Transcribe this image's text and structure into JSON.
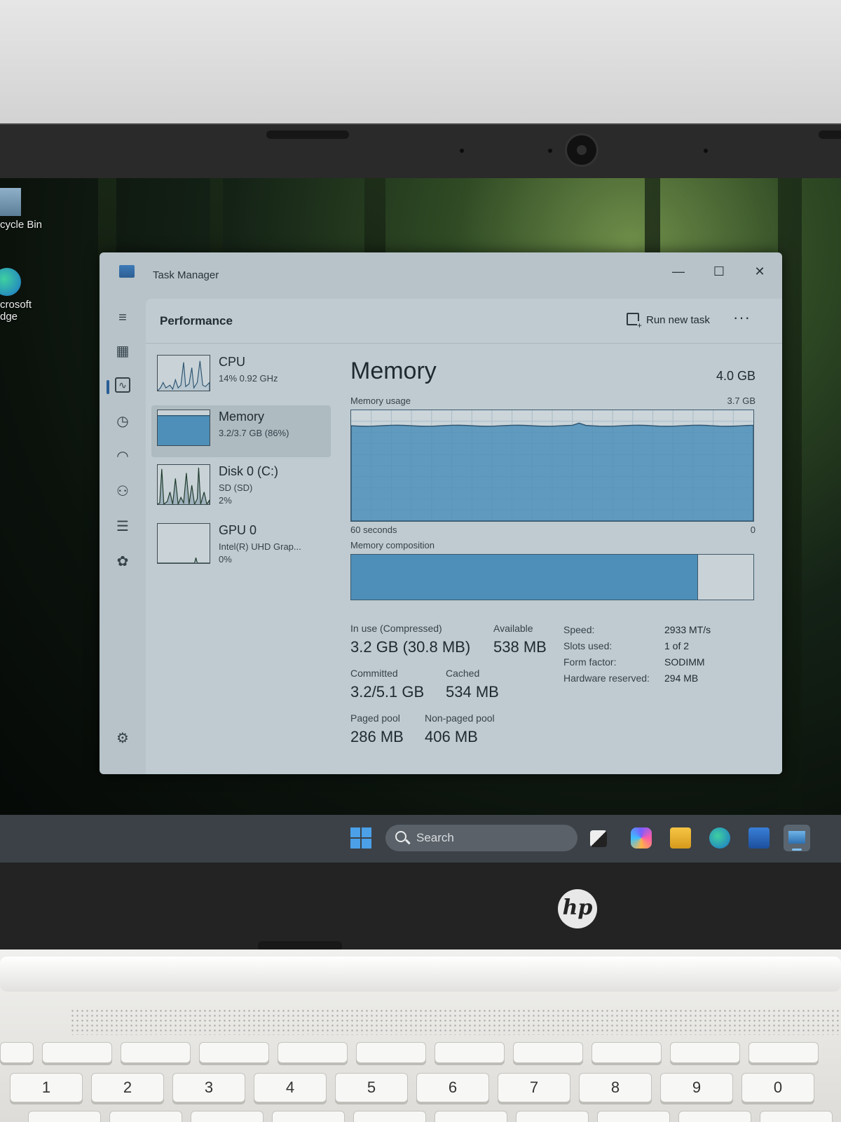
{
  "window": {
    "title": "Task Manager",
    "minimize": "—",
    "maximize": "☐",
    "close": "✕"
  },
  "desktop": {
    "recycle_bin": "cycle Bin",
    "edge_line1": "crosoft",
    "edge_line2": "dge"
  },
  "nav_icons": [
    "hamburger-icon",
    "processes-icon",
    "performance-icon",
    "app-history-icon",
    "startup-apps-icon",
    "users-icon",
    "details-icon",
    "services-icon",
    "settings-icon"
  ],
  "header": {
    "page_title": "Performance",
    "run_new_task": "Run new task",
    "more": "···"
  },
  "perf_list": [
    {
      "name": "CPU",
      "line1": "14% 0.92 GHz",
      "line2": ""
    },
    {
      "name": "Memory",
      "line1": "3.2/3.7 GB (86%)",
      "line2": ""
    },
    {
      "name": "Disk 0 (C:)",
      "line1": "SD (SD)",
      "line2": "2%"
    },
    {
      "name": "GPU 0",
      "line1": "Intel(R) UHD Grap...",
      "line2": "0%"
    }
  ],
  "memory": {
    "title": "Memory",
    "total": "4.0 GB",
    "usage_label": "Memory usage",
    "usage_max": "3.7 GB",
    "time_label": "60 seconds",
    "time_zero": "0",
    "composition_label": "Memory composition",
    "composition_in_use_fraction": 0.86,
    "usage_level_fraction": 0.86,
    "stats": {
      "in_use_label": "In use (Compressed)",
      "in_use_value": "3.2 GB (30.8 MB)",
      "available_label": "Available",
      "available_value": "538 MB",
      "committed_label": "Committed",
      "committed_value": "3.2/5.1 GB",
      "cached_label": "Cached",
      "cached_value": "534 MB",
      "paged_label": "Paged pool",
      "paged_value": "286 MB",
      "nonpaged_label": "Non-paged pool",
      "nonpaged_value": "406 MB"
    },
    "specs": [
      {
        "key": "Speed:",
        "value": "2933 MT/s"
      },
      {
        "key": "Slots used:",
        "value": "1 of 2"
      },
      {
        "key": "Form factor:",
        "value": "SODIMM"
      },
      {
        "key": "Hardware reserved:",
        "value": "294 MB"
      }
    ]
  },
  "taskbar": {
    "search_placeholder": "Search"
  },
  "laptop": {
    "brand": "hp"
  },
  "colors": {
    "accent": "#4d8fb8",
    "window_bg": "#bfcbd0"
  }
}
